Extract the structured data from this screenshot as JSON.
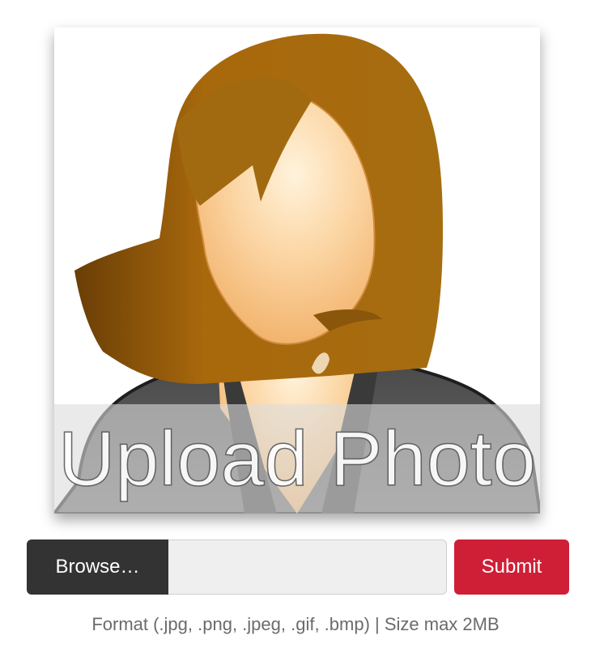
{
  "avatar": {
    "icon": "female-avatar-placeholder-icon",
    "overlay_text": "Upload Photo"
  },
  "upload": {
    "browse_label": "Browse…",
    "file_value": "",
    "submit_label": "Submit"
  },
  "hint": "Format (.jpg, .png, .jpeg, .gif, .bmp) | Size max 2MB",
  "colors": {
    "browse_bg": "#333333",
    "submit_bg": "#cf1f36",
    "field_bg": "#efefef",
    "hair": "#a2680f",
    "skin": "#fcd096",
    "suit": "#555555",
    "overlay": "#dcdcdc",
    "hint_text": "#6b6b6b"
  }
}
